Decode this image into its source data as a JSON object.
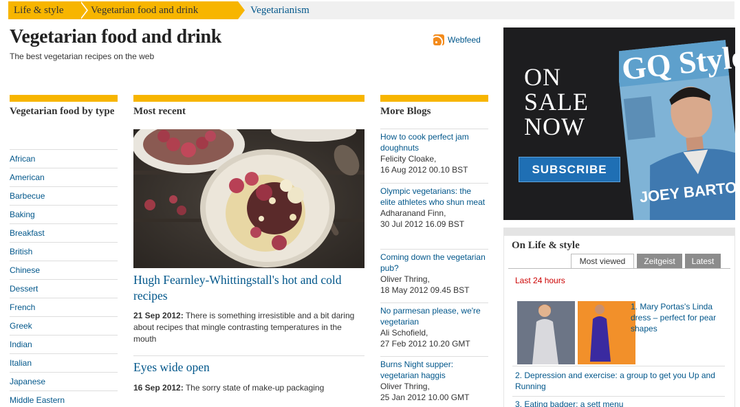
{
  "breadcrumb": [
    "Life & style",
    "Vegetarian food and drink",
    "Vegetarianism"
  ],
  "header": {
    "title": "Vegetarian food and drink",
    "subtitle": "The best vegetarian recipes on the web",
    "webfeed_label": "Webfeed"
  },
  "left_column": {
    "heading": "Vegetarian food by type",
    "items": [
      "African",
      "American",
      "Barbecue",
      "Baking",
      "Breakfast",
      "British",
      "Chinese",
      "Dessert",
      "French",
      "Greek",
      "Indian",
      "Italian",
      "Japanese",
      "Middle Eastern"
    ]
  },
  "middle_column": {
    "heading": "Most recent",
    "articles": [
      {
        "title": "Hugh Fearnley-Whittingstall's hot and cold recipes",
        "date": "21 Sep 2012:",
        "summary": "There is something irresistible and a bit daring about recipes that mingle contrasting temperatures in the mouth"
      },
      {
        "title": "Eyes wide open",
        "date": "16 Sep 2012:",
        "summary": "The sorry state of make-up packaging"
      }
    ]
  },
  "blogs_column": {
    "heading": "More Blogs",
    "items": [
      {
        "title": "How to cook perfect jam doughnuts",
        "author": "Felicity Cloake,",
        "date": "16 Aug 2012 00.10 BST"
      },
      {
        "title": "Olympic vegetarians: the elite athletes who shun meat",
        "author": "Adharanand Finn,",
        "date": "30 Jul 2012 16.09 BST"
      },
      {
        "title": "Coming down the vegetarian pub?",
        "author": "Oliver Thring,",
        "date": "18 May 2012 09.45 BST"
      },
      {
        "title": "No parmesan please, we're vegetarian",
        "author": "Ali Schofield,",
        "date": "27 Feb 2012 10.20 GMT"
      },
      {
        "title": "Burns Night supper: vegetarian haggis",
        "author": "Oliver Thring,",
        "date": "25 Jan 2012 10.00 GMT"
      }
    ]
  },
  "ad": {
    "line1": "ON",
    "line2": "SALE",
    "line3": "NOW",
    "button": "SUBSCRIBE",
    "magazine_text": "GQ Style",
    "cover_text": "JOEY BARTON"
  },
  "widget": {
    "title": "On Life & style",
    "tabs": [
      "Most viewed",
      "Zeitgeist",
      "Latest"
    ],
    "period": "Last 24 hours",
    "items": [
      {
        "num": "1.",
        "text": "Mary Portas's Linda dress – perfect for pear shapes"
      },
      {
        "num": "2.",
        "text": "Depression and exercise: a group to get you Up and Running"
      },
      {
        "num": "3.",
        "text": "Eating badger: a sett menu"
      }
    ]
  },
  "colors": {
    "accent": "#f7b500",
    "link": "#00568a",
    "ad_button": "#1f6fb4",
    "red": "#cc0000"
  }
}
